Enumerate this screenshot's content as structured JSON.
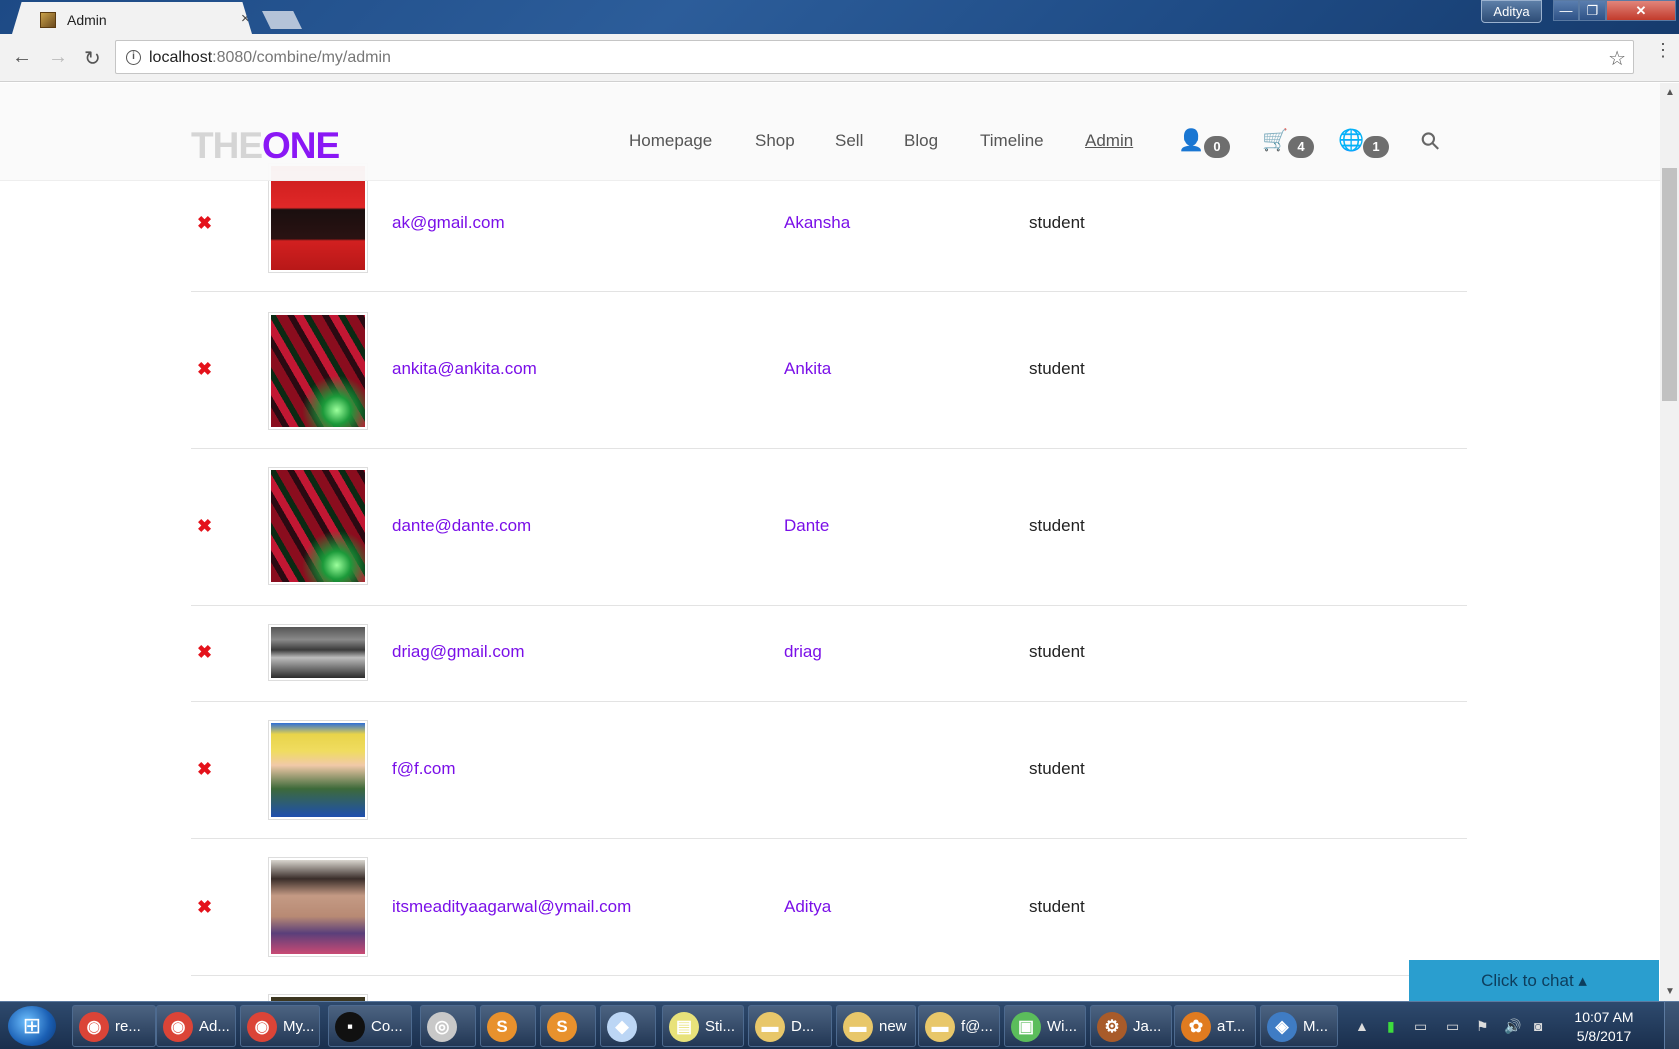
{
  "browser": {
    "tab_title": "Admin",
    "tab_close": "×",
    "url_host": "localhost",
    "url_path": ":8080/combine/my/admin",
    "user_badge": "Aditya",
    "min_glyph": "—",
    "max_glyph": "❐",
    "close_glyph": "✕",
    "back_glyph": "←",
    "forward_glyph": "→",
    "reload_glyph": "↻",
    "info_glyph": "i",
    "star_glyph": "☆",
    "menu_glyph": "⋮"
  },
  "site": {
    "logo_the": "THE",
    "logo_one": "ONE",
    "nav": [
      "Homepage",
      "Shop",
      "Sell",
      "Blog",
      "Timeline",
      "Admin"
    ],
    "active_nav": "Admin",
    "icons": {
      "user": {
        "glyph": "👤",
        "count": "0"
      },
      "cart": {
        "glyph": "🛒",
        "count": "4"
      },
      "notifications": {
        "glyph": "🌐",
        "count": "1"
      },
      "search": {
        "glyph": "⚲"
      }
    },
    "accent_color": "#8a17f5",
    "delete_color": "#e4121b"
  },
  "users": [
    {
      "delete_glyph": "✖",
      "email": "ak@gmail.com",
      "name": "Akansha",
      "role": "student",
      "avatar": "red-background-woman-avatar"
    },
    {
      "delete_glyph": "✖",
      "email": "ankita@ankita.com",
      "name": "Ankita",
      "role": "student",
      "avatar": "red-green-mecha-avatar"
    },
    {
      "delete_glyph": "✖",
      "email": "dante@dante.com",
      "name": "Dante",
      "role": "student",
      "avatar": "red-green-mecha-avatar"
    },
    {
      "delete_glyph": "✖",
      "email": "driag@gmail.com",
      "name": "driag",
      "role": "student",
      "avatar": "anime-ninja-avatar"
    },
    {
      "delete_glyph": "✖",
      "email": "f@f.com",
      "name": "",
      "role": "student",
      "avatar": "blonde-anime-avatar"
    },
    {
      "delete_glyph": "✖",
      "email": "itsmeadityaagarwal@ymail.com",
      "name": "Aditya",
      "role": "student",
      "avatar": "man-with-glasses-avatar"
    }
  ],
  "scrollbar": {
    "up_glyph": "▲",
    "down_glyph": "▼"
  },
  "chat": {
    "label": "Click to chat ▴"
  },
  "taskbar": {
    "start_glyph": "⊞",
    "items": [
      {
        "label": "re...",
        "icon": "chrome-icon",
        "glyph": "◉",
        "color": "#db4437"
      },
      {
        "label": "Ad...",
        "icon": "chrome-icon",
        "glyph": "◉",
        "color": "#db4437"
      },
      {
        "label": "My...",
        "icon": "chrome-icon",
        "glyph": "◉",
        "color": "#db4437"
      },
      {
        "label": "Co...",
        "icon": "terminal-icon",
        "glyph": "▪",
        "color": "#111111"
      },
      {
        "label": "",
        "icon": "compass-icon",
        "glyph": "◎",
        "color": "#c8c8c8"
      },
      {
        "label": "",
        "icon": "sublime-icon",
        "glyph": "S",
        "color": "#e8912d"
      },
      {
        "label": "",
        "icon": "sublime-icon",
        "glyph": "S",
        "color": "#e8912d"
      },
      {
        "label": "",
        "icon": "cube-icon",
        "glyph": "◆",
        "color": "#bcd6f5"
      },
      {
        "label": "Sti...",
        "icon": "sticky-notes-icon",
        "glyph": "▤",
        "color": "#e8e27a"
      },
      {
        "label": "D...",
        "icon": "folder-icon",
        "glyph": "▬",
        "color": "#e8c76a"
      },
      {
        "label": "new",
        "icon": "folder-icon",
        "glyph": "▬",
        "color": "#e8c76a"
      },
      {
        "label": "f@...",
        "icon": "folder-icon",
        "glyph": "▬",
        "color": "#e8c76a"
      },
      {
        "label": "Wi...",
        "icon": "monitor-icon",
        "glyph": "▣",
        "color": "#5bbd5b"
      },
      {
        "label": "Ja...",
        "icon": "java-ee-icon",
        "glyph": "⚙",
        "color": "#a85b2a"
      },
      {
        "label": "aT...",
        "icon": "tomcat-icon",
        "glyph": "✿",
        "color": "#e07b20"
      },
      {
        "label": "M...",
        "icon": "mysql-workbench-icon",
        "glyph": "◈",
        "color": "#3f7cc4"
      }
    ],
    "tray_glyphs": [
      "▲",
      "▮",
      "▭",
      "▭",
      "⚑",
      "🔊",
      "◙"
    ],
    "time": "10:07 AM",
    "date": "5/8/2017"
  }
}
